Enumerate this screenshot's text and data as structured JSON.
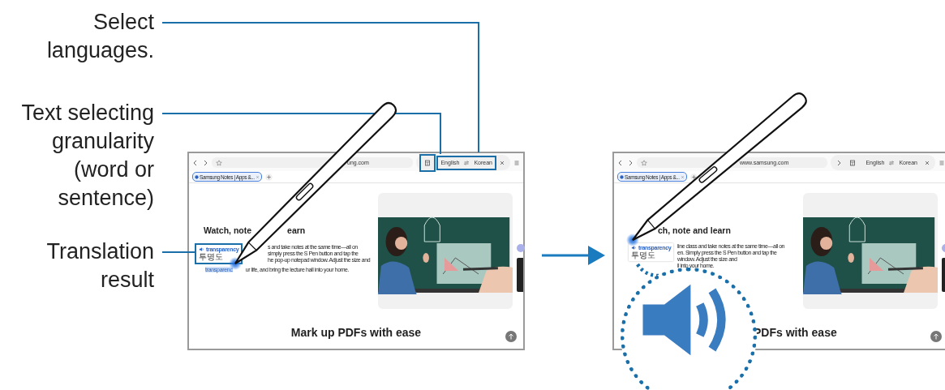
{
  "callouts": [
    {
      "text": "Select languages."
    },
    {
      "text": "Text selecting granularity (word or sentence)"
    },
    {
      "text": "Translation result"
    }
  ],
  "screens": [
    {
      "kind": "before",
      "annotated": true,
      "url": "ung.com",
      "tab": "Samsung Notes | Apps &...",
      "source_language": "English",
      "target_language": "Korean",
      "heading": [
        "Watch, note",
        "earn"
      ],
      "translation": {
        "word": "transparency",
        "meaning": "투명도"
      },
      "paragraph": [
        "s and take notes at the same time—all on",
        "simply press the S Pen button and tap the",
        "he pop-up notepad window. Adjust the size and"
      ],
      "selected_word": "transparenc",
      "last_line": "ur life, and bring the lecture hall into your home.",
      "section_title": "Mark up PDFs with ease"
    },
    {
      "kind": "after",
      "annotated": false,
      "url": "www.samsung.com",
      "tab": "Samsung Notes | Apps &...",
      "source_language": "English",
      "target_language": "Korean",
      "heading": [
        "ch, note and learn"
      ],
      "translation": {
        "word": "transparency",
        "meaning": "투명도"
      },
      "paragraph": [
        "line class and take notes at the same time—all on",
        "en. Simply press the S Pen button and tap the",
        "window. Adjust the size and",
        "ll into your home."
      ],
      "section_title": "PDFs with ease"
    }
  ]
}
